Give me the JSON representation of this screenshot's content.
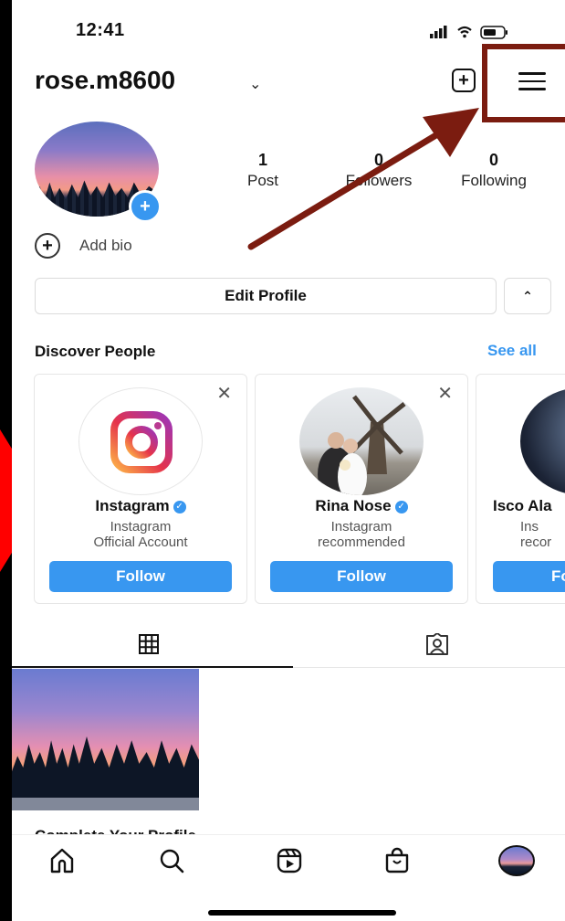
{
  "status": {
    "time": "12:41"
  },
  "header": {
    "username": "rose.m8600"
  },
  "stats": [
    {
      "value": "1",
      "label": "Post"
    },
    {
      "value": "0",
      "label": "Followers"
    },
    {
      "value": "0",
      "label": "Following"
    }
  ],
  "bio": {
    "add_label": "Add bio"
  },
  "buttons": {
    "edit_profile": "Edit Profile"
  },
  "discover": {
    "title": "Discover People",
    "see_all": "See all",
    "cards": [
      {
        "name": "Instagram",
        "verified": true,
        "subtitle_1": "Instagram",
        "subtitle_2": "Official Account",
        "action": "Follow"
      },
      {
        "name": "Rina Nose",
        "verified": true,
        "subtitle_1": "Instagram",
        "subtitle_2": "recommended",
        "action": "Follow"
      },
      {
        "name": "Isco Ala",
        "verified": false,
        "subtitle_1": "Ins",
        "subtitle_2": "recor",
        "action": "Fo"
      }
    ]
  },
  "partial_text": "Complete Your Profile",
  "icons": {
    "plus": "new-post-icon",
    "menu": "hamburger-menu-icon",
    "grid": "grid-icon",
    "tagged": "tagged-icon",
    "nav": [
      "home-icon",
      "search-icon",
      "reels-icon",
      "shop-icon",
      "profile-avatar-icon"
    ]
  },
  "colors": {
    "accent": "#3897f0",
    "annotation": "#7b1c10",
    "arrow_left": "#ff0000"
  }
}
